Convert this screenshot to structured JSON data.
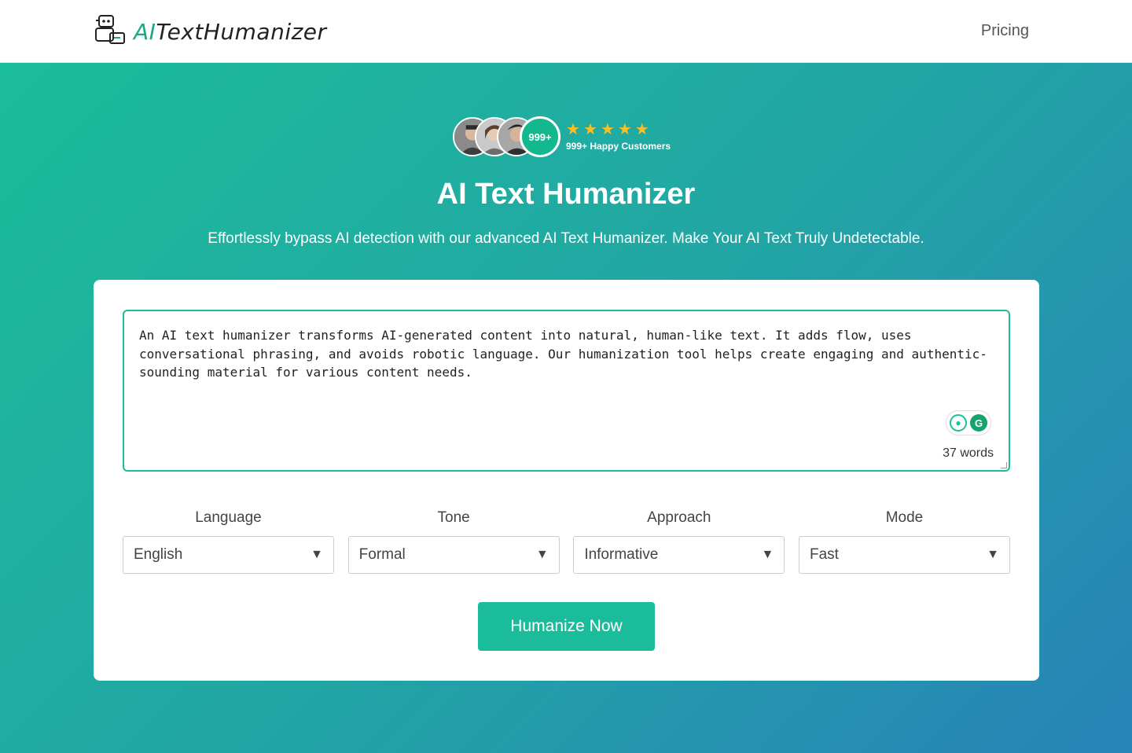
{
  "header": {
    "logo_ai": "AI",
    "logo_rest": "TextHumanizer",
    "logo_icon": "robot-icon",
    "nav_pricing": "Pricing"
  },
  "hero": {
    "customer_count_badge": "999+",
    "stars": 5,
    "happy_customers": "999+ Happy Customers",
    "title": "AI Text Humanizer",
    "subtitle": "Effortlessly bypass AI detection with our advanced AI Text Humanizer. Make Your AI Text Truly Undetectable."
  },
  "editor": {
    "text": "An AI text humanizer transforms AI-generated content into natural, human-like text. It adds flow, uses conversational phrasing, and avoids robotic language. Our humanization tool helps create engaging and authentic-sounding material for various content needs.",
    "word_count": "37 words",
    "extension_icons": [
      "lightbulb-icon",
      "grammarly-icon"
    ]
  },
  "options": {
    "language": {
      "label": "Language",
      "value": "English"
    },
    "tone": {
      "label": "Tone",
      "value": "Formal"
    },
    "approach": {
      "label": "Approach",
      "value": "Informative"
    },
    "mode": {
      "label": "Mode",
      "value": "Fast"
    }
  },
  "cta": {
    "label": "Humanize Now"
  },
  "colors": {
    "accent": "#1bbc9b",
    "gradient_start": "#1bbc9b",
    "gradient_end": "#2783b8",
    "star": "#fbbf24"
  }
}
